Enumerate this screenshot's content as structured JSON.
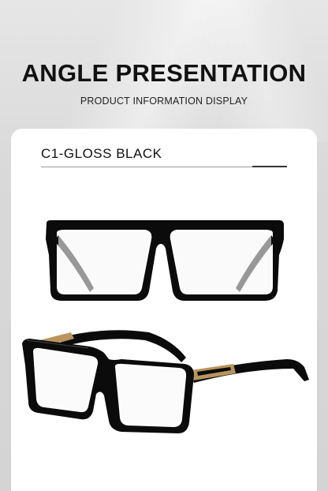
{
  "header": {
    "title": "ANGLE PRESENTATION",
    "subtitle": "PRODUCT INFORMATION DISPLAY"
  },
  "product": {
    "color_label": "C1-GLOSS BLACK"
  },
  "colors": {
    "frame": "#0b0b0b",
    "hinge_gold": "#b8955c",
    "card": "#ffffff",
    "background": "#dcdcdc"
  }
}
